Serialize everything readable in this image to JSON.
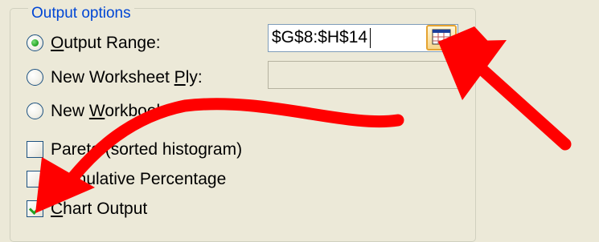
{
  "group": {
    "legend": "Output options"
  },
  "options": {
    "output_range": {
      "label_pre": "",
      "label_acc": "O",
      "label_post": "utput Range:",
      "selected": true
    },
    "new_worksheet": {
      "label_pre": "New Worksheet ",
      "label_acc": "P",
      "label_post": "ly:",
      "selected": false
    },
    "new_workbook": {
      "label_pre": "New ",
      "label_acc": "W",
      "label_post": "orkbook",
      "selected": false
    }
  },
  "range_input": {
    "value": "$G$8:$H$14"
  },
  "checkboxes": {
    "pareto": {
      "label": "Pareto (sorted histogram)",
      "checked": false
    },
    "cumulative": {
      "label": "Cumulative Percentage",
      "checked": false
    },
    "chart_output": {
      "label_pre": "",
      "label_acc": "C",
      "label_post": "hart Output",
      "checked": true
    }
  },
  "icons": {
    "range_selector": "collapse-dialog-icon",
    "annotation_arrows": "red-arrow-icon"
  },
  "colors": {
    "legend": "#0046D5",
    "check_mark": "#21A121",
    "arrow": "#FF0000"
  }
}
